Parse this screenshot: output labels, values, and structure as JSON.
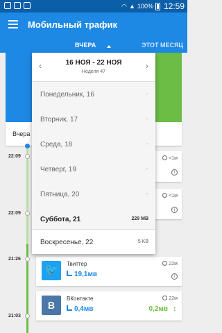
{
  "status_bar": {
    "battery": "100%",
    "time": "12:59"
  },
  "app_bar": {
    "title": "Мобильный трафик"
  },
  "tabs": {
    "yesterday": "ВЧЕРА",
    "this_month": "ЭТОТ МЕСЯЦ"
  },
  "summary": {
    "label": "Вчера"
  },
  "week_picker": {
    "range": "16 НОЯ - 22 НОЯ",
    "week": "Неделя 47",
    "days": [
      {
        "label": "Понедельник, 16",
        "value": "–"
      },
      {
        "label": "Вторник, 17",
        "value": "–"
      },
      {
        "label": "Среда, 18",
        "value": "–"
      },
      {
        "label": "Четверг, 19",
        "value": "–"
      },
      {
        "label": "Пятница, 20",
        "value": "–"
      },
      {
        "label": "Суббота, 21",
        "value": "229 MB"
      }
    ],
    "next_week_day": {
      "label": "Воскресенье, 22",
      "value": "5 KB"
    }
  },
  "timeline": {
    "times": [
      "22:09",
      "22:09",
      "21:26",
      "21:03"
    ],
    "cards": [
      {
        "duration": "<1м"
      },
      {
        "duration": "<1м"
      },
      {
        "app": "Твиттер",
        "icon_letter": "",
        "color": "#1da1f2",
        "data": "19,1мв",
        "duration": "22м"
      },
      {
        "app": "ВКонтакте",
        "icon_letter": "B",
        "color": "#4a76a8",
        "data": "0,4мв",
        "upload": "0,2мв",
        "duration": "22м"
      }
    ]
  }
}
